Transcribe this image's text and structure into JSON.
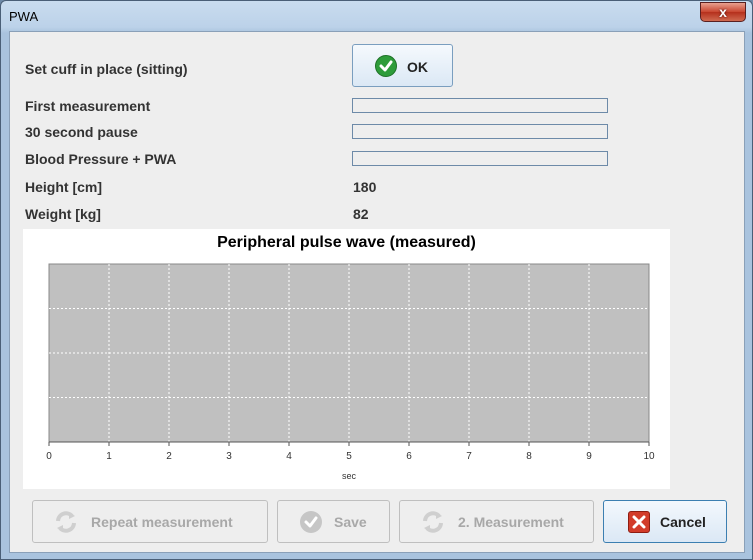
{
  "window": {
    "title": "PWA",
    "close_glyph": "x"
  },
  "rows": [
    {
      "label": "Set cuff in place (sitting)"
    },
    {
      "label": "First measurement",
      "progress": 0
    },
    {
      "label": "30 second pause",
      "progress": 0
    },
    {
      "label": "Blood Pressure + PWA",
      "progress": 0
    },
    {
      "label": "Height [cm]",
      "value": "180"
    },
    {
      "label": "Weight [kg]",
      "value": "82"
    }
  ],
  "ok_button": {
    "label": "OK",
    "icon": "check-circle-icon"
  },
  "chart_data": {
    "type": "line",
    "title": "Peripheral pulse wave (measured)",
    "xlabel": "sec",
    "ylabel": "",
    "xlim": [
      0,
      10
    ],
    "x_ticks": [
      "0",
      "1",
      "2",
      "3",
      "4",
      "5",
      "6",
      "7",
      "8",
      "9",
      "10"
    ],
    "grid": true,
    "series": [],
    "plot_background": "#c0c0c0",
    "grid_color": "#ffffff"
  },
  "buttons": {
    "repeat": {
      "label": "Repeat measurement",
      "icon": "refresh-icon",
      "enabled": false
    },
    "save": {
      "label": "Save",
      "icon": "check-circle-icon",
      "enabled": false
    },
    "second": {
      "label": "2. Measurement",
      "icon": "refresh-icon",
      "enabled": false
    },
    "cancel": {
      "label": "Cancel",
      "icon": "cancel-x-icon",
      "enabled": true
    }
  },
  "colors": {
    "titlebar": "#bcd2e9",
    "close_button": "#c8452f",
    "ok_check": "#2e9c3a",
    "cancel_icon": "#d23c2a"
  }
}
